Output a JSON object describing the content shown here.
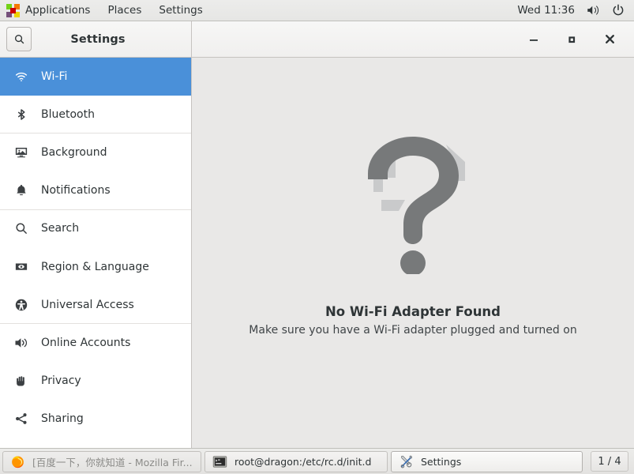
{
  "top_panel": {
    "applications_label": "Applications",
    "places_label": "Places",
    "settings_label": "Settings",
    "clock": "Wed 11:36",
    "volume_icon": "speaker-icon",
    "power_icon": "power-icon",
    "apps_icon": "applications-pinwheel-icon"
  },
  "window": {
    "title": "Settings",
    "search_icon": "search-icon",
    "minimize_label": "–",
    "maximize_label": "□",
    "close_label": "✕"
  },
  "sidebar": {
    "items": [
      {
        "label": "Wi-Fi",
        "icon": "wifi-icon",
        "selected": true
      },
      {
        "label": "Bluetooth",
        "icon": "bluetooth-icon",
        "selected": false
      },
      {
        "label": "Background",
        "icon": "background-icon",
        "selected": false
      },
      {
        "label": "Notifications",
        "icon": "bell-icon",
        "selected": false
      },
      {
        "label": "Search",
        "icon": "search-icon",
        "selected": false
      },
      {
        "label": "Region & Language",
        "icon": "flag-language-icon",
        "selected": false
      },
      {
        "label": "Universal Access",
        "icon": "accessibility-icon",
        "selected": false
      },
      {
        "label": "Online Accounts",
        "icon": "online-accounts-icon",
        "selected": false
      },
      {
        "label": "Privacy",
        "icon": "hand-icon",
        "selected": false
      },
      {
        "label": "Sharing",
        "icon": "share-icon",
        "selected": false
      }
    ]
  },
  "content": {
    "placeholder_icon": "question-mark-icon",
    "title": "No Wi-Fi Adapter Found",
    "subtitle": "Make sure you have a Wi-Fi adapter plugged and turned on"
  },
  "taskbar": {
    "tasks": [
      {
        "label": "[百度一下，你就知道 - Mozilla Fir...",
        "icon": "firefox-icon",
        "state": "inactive"
      },
      {
        "label": "root@dragon:/etc/rc.d/init.d",
        "icon": "terminal-icon",
        "state": "normal"
      },
      {
        "label": "Settings",
        "icon": "tools-icon",
        "state": "active"
      }
    ],
    "workspace": "1 / 4"
  },
  "colors": {
    "accent": "#4a90d9",
    "panel_bg": "#e8e8e6",
    "content_bg": "#e9e8e7",
    "sidebar_bg": "#ffffff",
    "text": "#2e3436",
    "placeholder_gray": "#77797a"
  }
}
